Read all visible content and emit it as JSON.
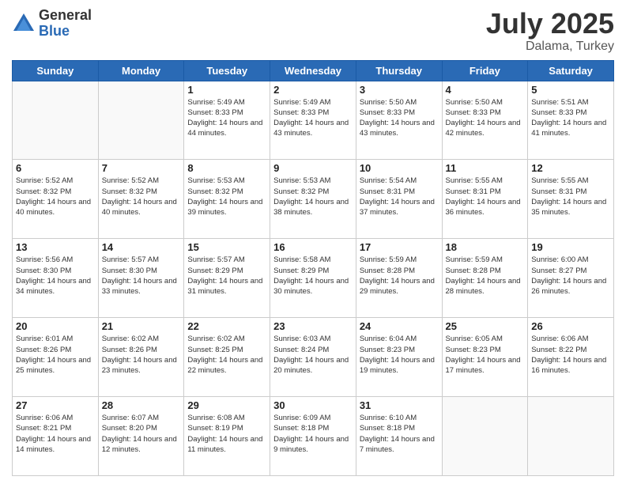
{
  "logo": {
    "general": "General",
    "blue": "Blue"
  },
  "header": {
    "month": "July 2025",
    "location": "Dalama, Turkey"
  },
  "days_of_week": [
    "Sunday",
    "Monday",
    "Tuesday",
    "Wednesday",
    "Thursday",
    "Friday",
    "Saturday"
  ],
  "weeks": [
    [
      {
        "day": "",
        "info": ""
      },
      {
        "day": "",
        "info": ""
      },
      {
        "day": "1",
        "info": "Sunrise: 5:49 AM\nSunset: 8:33 PM\nDaylight: 14 hours and 44 minutes."
      },
      {
        "day": "2",
        "info": "Sunrise: 5:49 AM\nSunset: 8:33 PM\nDaylight: 14 hours and 43 minutes."
      },
      {
        "day": "3",
        "info": "Sunrise: 5:50 AM\nSunset: 8:33 PM\nDaylight: 14 hours and 43 minutes."
      },
      {
        "day": "4",
        "info": "Sunrise: 5:50 AM\nSunset: 8:33 PM\nDaylight: 14 hours and 42 minutes."
      },
      {
        "day": "5",
        "info": "Sunrise: 5:51 AM\nSunset: 8:33 PM\nDaylight: 14 hours and 41 minutes."
      }
    ],
    [
      {
        "day": "6",
        "info": "Sunrise: 5:52 AM\nSunset: 8:32 PM\nDaylight: 14 hours and 40 minutes."
      },
      {
        "day": "7",
        "info": "Sunrise: 5:52 AM\nSunset: 8:32 PM\nDaylight: 14 hours and 40 minutes."
      },
      {
        "day": "8",
        "info": "Sunrise: 5:53 AM\nSunset: 8:32 PM\nDaylight: 14 hours and 39 minutes."
      },
      {
        "day": "9",
        "info": "Sunrise: 5:53 AM\nSunset: 8:32 PM\nDaylight: 14 hours and 38 minutes."
      },
      {
        "day": "10",
        "info": "Sunrise: 5:54 AM\nSunset: 8:31 PM\nDaylight: 14 hours and 37 minutes."
      },
      {
        "day": "11",
        "info": "Sunrise: 5:55 AM\nSunset: 8:31 PM\nDaylight: 14 hours and 36 minutes."
      },
      {
        "day": "12",
        "info": "Sunrise: 5:55 AM\nSunset: 8:31 PM\nDaylight: 14 hours and 35 minutes."
      }
    ],
    [
      {
        "day": "13",
        "info": "Sunrise: 5:56 AM\nSunset: 8:30 PM\nDaylight: 14 hours and 34 minutes."
      },
      {
        "day": "14",
        "info": "Sunrise: 5:57 AM\nSunset: 8:30 PM\nDaylight: 14 hours and 33 minutes."
      },
      {
        "day": "15",
        "info": "Sunrise: 5:57 AM\nSunset: 8:29 PM\nDaylight: 14 hours and 31 minutes."
      },
      {
        "day": "16",
        "info": "Sunrise: 5:58 AM\nSunset: 8:29 PM\nDaylight: 14 hours and 30 minutes."
      },
      {
        "day": "17",
        "info": "Sunrise: 5:59 AM\nSunset: 8:28 PM\nDaylight: 14 hours and 29 minutes."
      },
      {
        "day": "18",
        "info": "Sunrise: 5:59 AM\nSunset: 8:28 PM\nDaylight: 14 hours and 28 minutes."
      },
      {
        "day": "19",
        "info": "Sunrise: 6:00 AM\nSunset: 8:27 PM\nDaylight: 14 hours and 26 minutes."
      }
    ],
    [
      {
        "day": "20",
        "info": "Sunrise: 6:01 AM\nSunset: 8:26 PM\nDaylight: 14 hours and 25 minutes."
      },
      {
        "day": "21",
        "info": "Sunrise: 6:02 AM\nSunset: 8:26 PM\nDaylight: 14 hours and 23 minutes."
      },
      {
        "day": "22",
        "info": "Sunrise: 6:02 AM\nSunset: 8:25 PM\nDaylight: 14 hours and 22 minutes."
      },
      {
        "day": "23",
        "info": "Sunrise: 6:03 AM\nSunset: 8:24 PM\nDaylight: 14 hours and 20 minutes."
      },
      {
        "day": "24",
        "info": "Sunrise: 6:04 AM\nSunset: 8:23 PM\nDaylight: 14 hours and 19 minutes."
      },
      {
        "day": "25",
        "info": "Sunrise: 6:05 AM\nSunset: 8:23 PM\nDaylight: 14 hours and 17 minutes."
      },
      {
        "day": "26",
        "info": "Sunrise: 6:06 AM\nSunset: 8:22 PM\nDaylight: 14 hours and 16 minutes."
      }
    ],
    [
      {
        "day": "27",
        "info": "Sunrise: 6:06 AM\nSunset: 8:21 PM\nDaylight: 14 hours and 14 minutes."
      },
      {
        "day": "28",
        "info": "Sunrise: 6:07 AM\nSunset: 8:20 PM\nDaylight: 14 hours and 12 minutes."
      },
      {
        "day": "29",
        "info": "Sunrise: 6:08 AM\nSunset: 8:19 PM\nDaylight: 14 hours and 11 minutes."
      },
      {
        "day": "30",
        "info": "Sunrise: 6:09 AM\nSunset: 8:18 PM\nDaylight: 14 hours and 9 minutes."
      },
      {
        "day": "31",
        "info": "Sunrise: 6:10 AM\nSunset: 8:18 PM\nDaylight: 14 hours and 7 minutes."
      },
      {
        "day": "",
        "info": ""
      },
      {
        "day": "",
        "info": ""
      }
    ]
  ]
}
